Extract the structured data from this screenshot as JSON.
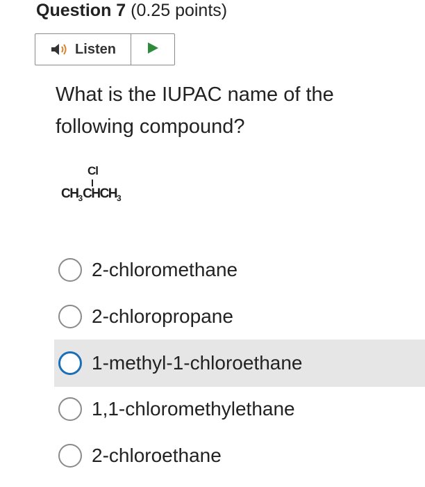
{
  "question": {
    "number_label": "Question 7",
    "points_label": "(0.25 points)"
  },
  "listen": {
    "label": "Listen",
    "speaker_icon": "speaker-icon",
    "play_icon": "play-icon",
    "play_color": "#2e8b3a"
  },
  "prompt": "What is the IUPAC name of the following compound?",
  "compound": {
    "substituent": "Cl",
    "formula_parts": [
      "CH",
      "3",
      "CHCH",
      "3"
    ]
  },
  "options": [
    {
      "label": "2-chloromethane",
      "selected": false,
      "hovered": false
    },
    {
      "label": "2-chloropropane",
      "selected": false,
      "hovered": false
    },
    {
      "label": "1-methyl-1-chloroethane",
      "selected": false,
      "hovered": true
    },
    {
      "label": "1,1-chloromethylethane",
      "selected": false,
      "hovered": false
    },
    {
      "label": "2-chloroethane",
      "selected": false,
      "hovered": false
    }
  ],
  "colors": {
    "focus_ring": "#1a6fb8",
    "hover_bg": "#e6e6e6"
  }
}
